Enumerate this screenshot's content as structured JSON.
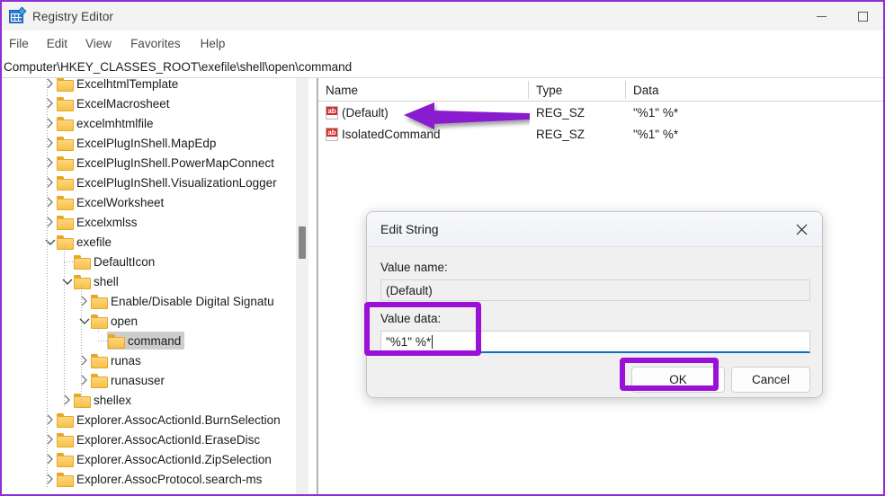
{
  "window": {
    "title": "Registry Editor",
    "icon": "registry-editor-icon",
    "minimize_label": "Minimize",
    "maximize_label": "Maximize"
  },
  "menubar": {
    "items": [
      {
        "label": "File"
      },
      {
        "label": "Edit"
      },
      {
        "label": "View"
      },
      {
        "label": "Favorites"
      },
      {
        "label": "Help"
      }
    ]
  },
  "address": {
    "path": "Computer\\HKEY_CLASSES_ROOT\\exefile\\shell\\open\\command"
  },
  "tree": {
    "nodes": [
      {
        "label": "ExcelhtmlTemplate",
        "indent": 0,
        "state": "collapsed",
        "selected": false
      },
      {
        "label": "ExcelMacrosheet",
        "indent": 0,
        "state": "collapsed",
        "selected": false
      },
      {
        "label": "excelmhtmlfile",
        "indent": 0,
        "state": "collapsed",
        "selected": false
      },
      {
        "label": "ExcelPlugInShell.MapEdp",
        "indent": 0,
        "state": "collapsed",
        "selected": false
      },
      {
        "label": "ExcelPlugInShell.PowerMapConnect",
        "indent": 0,
        "state": "collapsed",
        "selected": false
      },
      {
        "label": "ExcelPlugInShell.VisualizationLogger",
        "indent": 0,
        "state": "collapsed",
        "selected": false
      },
      {
        "label": "ExcelWorksheet",
        "indent": 0,
        "state": "collapsed",
        "selected": false
      },
      {
        "label": "Excelxmlss",
        "indent": 0,
        "state": "collapsed",
        "selected": false
      },
      {
        "label": "exefile",
        "indent": 0,
        "state": "expanded",
        "selected": false
      },
      {
        "label": "DefaultIcon",
        "indent": 1,
        "state": "leaf",
        "selected": false
      },
      {
        "label": "shell",
        "indent": 1,
        "state": "expanded",
        "selected": false
      },
      {
        "label": "Enable/Disable Digital Signatu",
        "indent": 2,
        "state": "collapsed",
        "selected": false
      },
      {
        "label": "open",
        "indent": 2,
        "state": "expanded",
        "selected": false
      },
      {
        "label": "command",
        "indent": 3,
        "state": "leaf",
        "selected": true
      },
      {
        "label": "runas",
        "indent": 2,
        "state": "collapsed",
        "selected": false
      },
      {
        "label": "runasuser",
        "indent": 2,
        "state": "collapsed",
        "selected": false
      },
      {
        "label": "shellex",
        "indent": 1,
        "state": "collapsed",
        "selected": false
      },
      {
        "label": "Explorer.AssocActionId.BurnSelection",
        "indent": 0,
        "state": "collapsed",
        "selected": false
      },
      {
        "label": "Explorer.AssocActionId.EraseDisc",
        "indent": 0,
        "state": "collapsed",
        "selected": false
      },
      {
        "label": "Explorer.AssocActionId.ZipSelection",
        "indent": 0,
        "state": "collapsed",
        "selected": false
      },
      {
        "label": "Explorer.AssocProtocol.search-ms",
        "indent": 0,
        "state": "collapsed",
        "selected": false
      }
    ]
  },
  "values": {
    "columns": [
      {
        "label": "Name"
      },
      {
        "label": "Type"
      },
      {
        "label": "Data"
      }
    ],
    "rows": [
      {
        "icon": "string-value-icon",
        "name": "(Default)",
        "type": "REG_SZ",
        "data": "\"%1\" %*"
      },
      {
        "icon": "string-value-icon",
        "name": "IsolatedCommand",
        "type": "REG_SZ",
        "data": "\"%1\" %*"
      }
    ]
  },
  "dialog": {
    "title": "Edit String",
    "close_label": "Close",
    "value_name_label": "Value name:",
    "value_name": "(Default)",
    "value_data_label": "Value data:",
    "value_data": "\"%1\" %*",
    "ok_label": "OK",
    "cancel_label": "Cancel"
  },
  "annotations": {
    "arrow_color": "#8a1fd0",
    "highlight_color": "#9b10d6",
    "highlight_targets": [
      "value-data-field",
      "ok-button"
    ],
    "arrow_target": "default-value-row"
  }
}
